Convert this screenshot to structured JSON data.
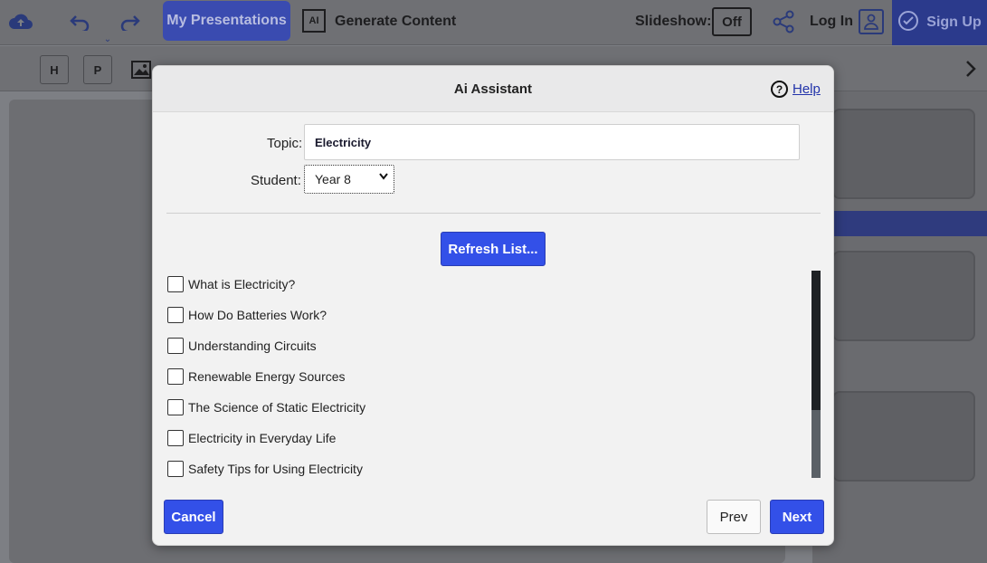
{
  "header": {
    "my_presentations": "My Presentations",
    "ai_icon_text": "AI",
    "generate_content": "Generate Content",
    "slideshow_label": "Slideshow:",
    "slideshow_value": "Off",
    "login": "Log In",
    "signup": "Sign Up"
  },
  "toolbar": {
    "heading_tool": "H",
    "paragraph_tool": "P"
  },
  "modal": {
    "title": "Ai Assistant",
    "help": "Help",
    "topic_label": "Topic:",
    "topic_value": "Electricity",
    "student_label": "Student:",
    "student_value": "Year 8",
    "refresh_label": "Refresh List...",
    "items": [
      {
        "label": "What is Electricity?",
        "checked": false
      },
      {
        "label": "How Do Batteries Work?",
        "checked": false
      },
      {
        "label": "Understanding Circuits",
        "checked": false
      },
      {
        "label": "Renewable Energy Sources",
        "checked": false
      },
      {
        "label": "The Science of Static Electricity",
        "checked": false
      },
      {
        "label": "Electricity in Everyday Life",
        "checked": false
      },
      {
        "label": "Safety Tips for Using Electricity",
        "checked": false
      }
    ],
    "cancel_label": "Cancel",
    "prev_label": "Prev",
    "next_label": "Next"
  },
  "colors": {
    "accent": "#3350e8",
    "signup_bg": "#2b3a8c"
  },
  "icons": [
    "cloud-upload-icon",
    "undo-icon",
    "redo-icon",
    "share-icon",
    "user-icon",
    "check-circle-icon",
    "image-icon",
    "chevron-right-icon",
    "help-icon"
  ]
}
